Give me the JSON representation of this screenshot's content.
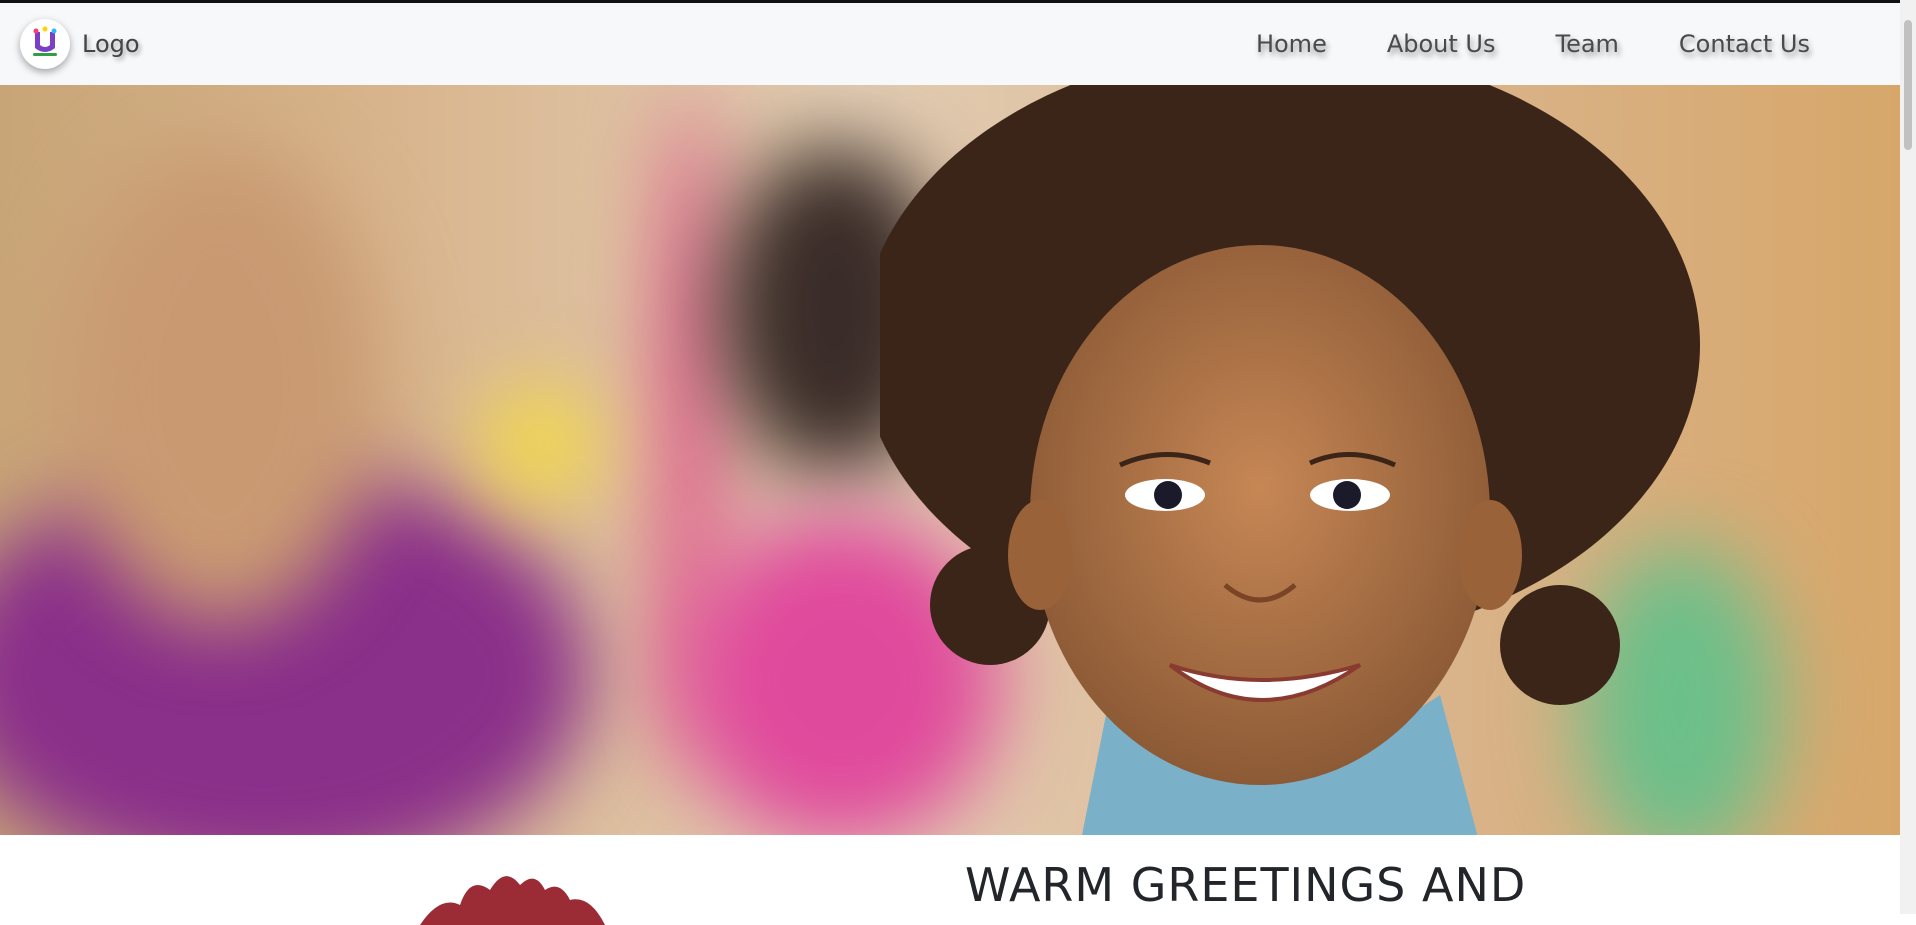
{
  "navbar": {
    "brand_label": "Logo",
    "links": [
      "Home",
      "About Us",
      "Team",
      "Contact Us"
    ]
  },
  "section": {
    "heading": "WARM GREETINGS AND"
  },
  "colors": {
    "navbar_bg": "#f7f8fa",
    "nav_text": "#4a4a4a",
    "heading_text": "#22252a",
    "graphic_red": "#9b2b34"
  }
}
